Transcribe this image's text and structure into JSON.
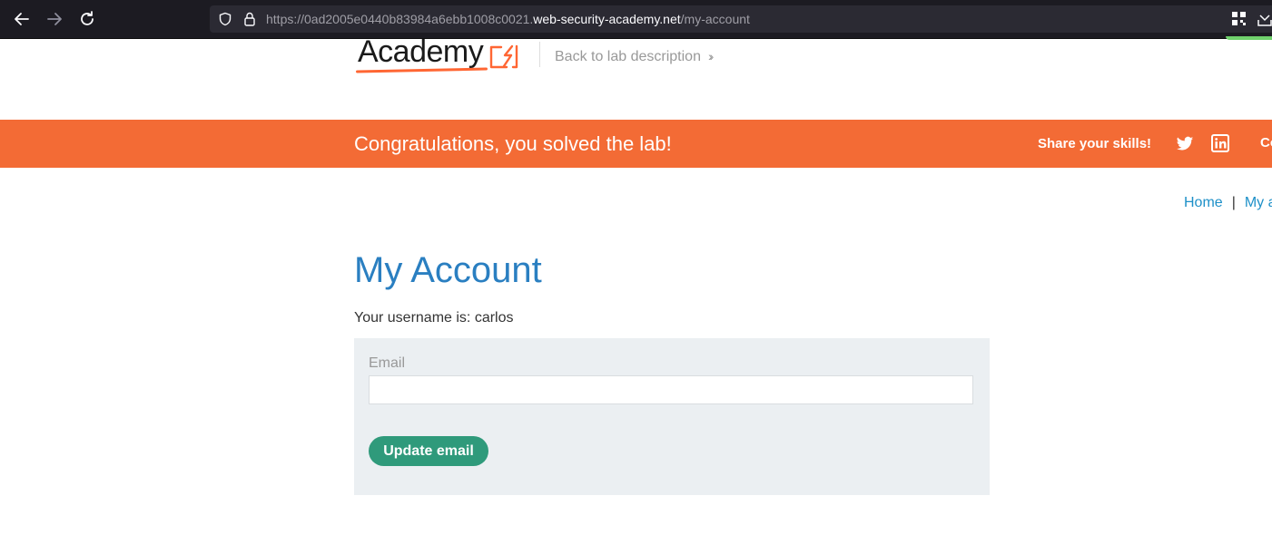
{
  "browser": {
    "url_prefix": "https://0ad2005e0440b83984a6ebb1008c0021.",
    "url_host": "web-security-academy.net",
    "url_path": "/my-account",
    "icons": [
      "back-arrow-icon",
      "forward-arrow-icon",
      "reload-icon",
      "shield-icon",
      "lock-icon",
      "extensions-icon",
      "downloads-icon"
    ]
  },
  "header": {
    "logo_text": "Academy",
    "back_link": "Back to lab description",
    "back_link_icon": "double-chevron-right"
  },
  "banner": {
    "message": "Congratulations, you solved the lab!",
    "share_label": "Share your skills!",
    "cut_text": "Co",
    "icons": [
      "twitter-icon",
      "linkedin-icon"
    ]
  },
  "breadcrumb": {
    "home": "Home",
    "separator": "|",
    "current": "My a"
  },
  "main": {
    "title": "My Account",
    "username_text": "Your username is: carlos",
    "form": {
      "email_label": "Email",
      "email_value": "",
      "submit_label": "Update email"
    }
  },
  "colors": {
    "banner": "#f36b35",
    "title": "#2a7fc1",
    "button": "#2f9a7b",
    "link": "#1e90c8",
    "form_bg": "#ebeff2"
  }
}
